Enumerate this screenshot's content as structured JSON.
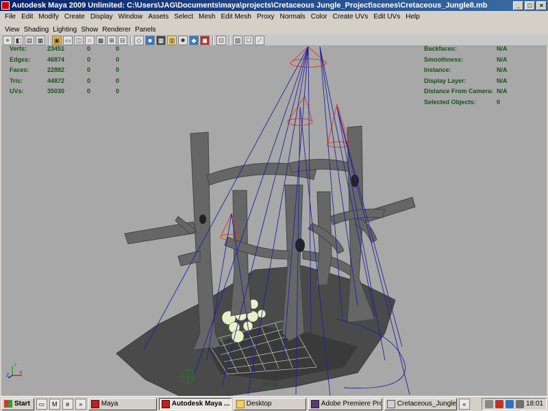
{
  "window": {
    "title": "Autodesk Maya 2009 Unlimited: C:\\Users\\JAG\\Documents\\maya\\projects\\Cretaceous Jungle_Project\\scenes\\Cretaceous_Jungle8.mb",
    "minimize": "_",
    "maximize": "□",
    "close": "×"
  },
  "menu": [
    "File",
    "Edit",
    "Modify",
    "Create",
    "Display",
    "Window",
    "Assets",
    "Select",
    "Mesh",
    "Edit Mesh",
    "Proxy",
    "Normals",
    "Color",
    "Create UVs",
    "Edit UVs",
    "Help"
  ],
  "panel_menu": [
    "View",
    "Shading",
    "Lighting",
    "Show",
    "Renderer",
    "Panels"
  ],
  "hud_left": [
    {
      "label": "Verts:",
      "a": "23451",
      "b": "0",
      "c": "0"
    },
    {
      "label": "Edges:",
      "a": "46874",
      "b": "0",
      "c": "0"
    },
    {
      "label": "Faces:",
      "a": "22882",
      "b": "0",
      "c": "0"
    },
    {
      "label": "Tris:",
      "a": "44872",
      "b": "0",
      "c": "0"
    },
    {
      "label": "UVs:",
      "a": "35030",
      "b": "0",
      "c": "0"
    }
  ],
  "hud_right": [
    {
      "label": "Backfaces:",
      "value": "N/A"
    },
    {
      "label": "Smoothness:",
      "value": "N/A"
    },
    {
      "label": "Instance:",
      "value": "N/A"
    },
    {
      "label": "Display Layer:",
      "value": "N/A"
    },
    {
      "label": "Distance From Camera:",
      "value": "N/A"
    },
    {
      "label": "Selected Objects:",
      "value": "0"
    }
  ],
  "camera_label": "persp",
  "axes": {
    "x": "X",
    "y": "Y",
    "z": "Z"
  },
  "taskbar": {
    "start": "Start",
    "tasks": [
      {
        "label": "Maya",
        "active": false
      },
      {
        "label": "Autodesk Maya ...",
        "active": true
      },
      {
        "label": "Desktop",
        "active": false
      },
      {
        "label": "Adobe Premiere Pro -...",
        "active": false
      },
      {
        "label": "Cretaceous_Jungle_...",
        "active": false
      }
    ],
    "clock": "18:01"
  },
  "colors": {
    "viewport": "#a8a8a8",
    "hud_text": "#1c4f1c",
    "titlebar": "#0a246a",
    "light_cone": "#e04020",
    "light_line": "#2020a0"
  }
}
